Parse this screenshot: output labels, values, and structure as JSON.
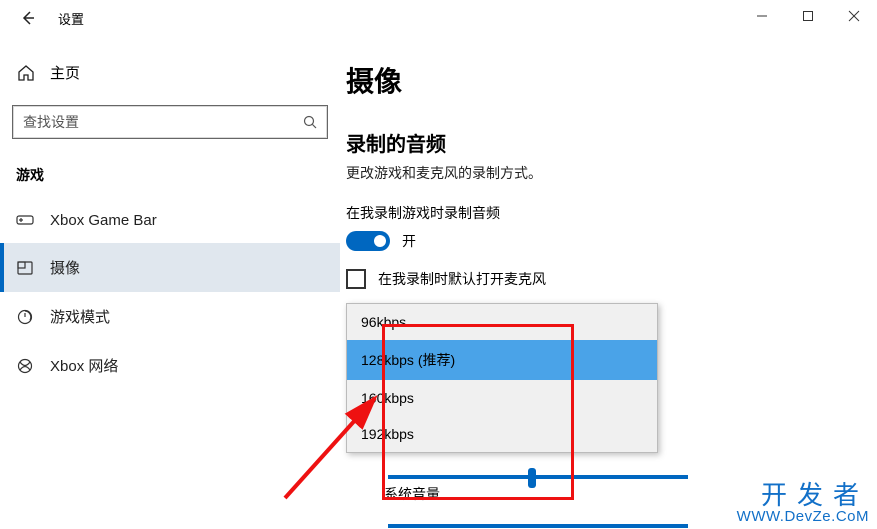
{
  "window": {
    "title": "设置"
  },
  "sidebar": {
    "home_label": "主页",
    "search_placeholder": "查找设置",
    "group_label": "游戏",
    "items": [
      {
        "icon_name": "game-bar-icon",
        "label": "Xbox Game Bar"
      },
      {
        "icon_name": "capture-icon",
        "label": "摄像"
      },
      {
        "icon_name": "game-mode-icon",
        "label": "游戏模式"
      },
      {
        "icon_name": "xbox-net-icon",
        "label": "Xbox 网络"
      }
    ]
  },
  "content": {
    "page_title": "摄像",
    "section_title": "录制的音频",
    "section_sub": "更改游戏和麦克风的录制方式。",
    "toggle_label": "在我录制游戏时录制音频",
    "toggle_state": "开",
    "checkbox_label": "在我录制时默认打开麦克风",
    "bitrate_options": [
      "96kbps",
      "128kbps (推荐)",
      "160kbps",
      "192kbps"
    ],
    "bitrate_selected_index": 1,
    "sys_volume_label": "系统音量"
  },
  "watermark": {
    "line1": "开发者",
    "line2": "WWW.DevZe.CoM"
  }
}
